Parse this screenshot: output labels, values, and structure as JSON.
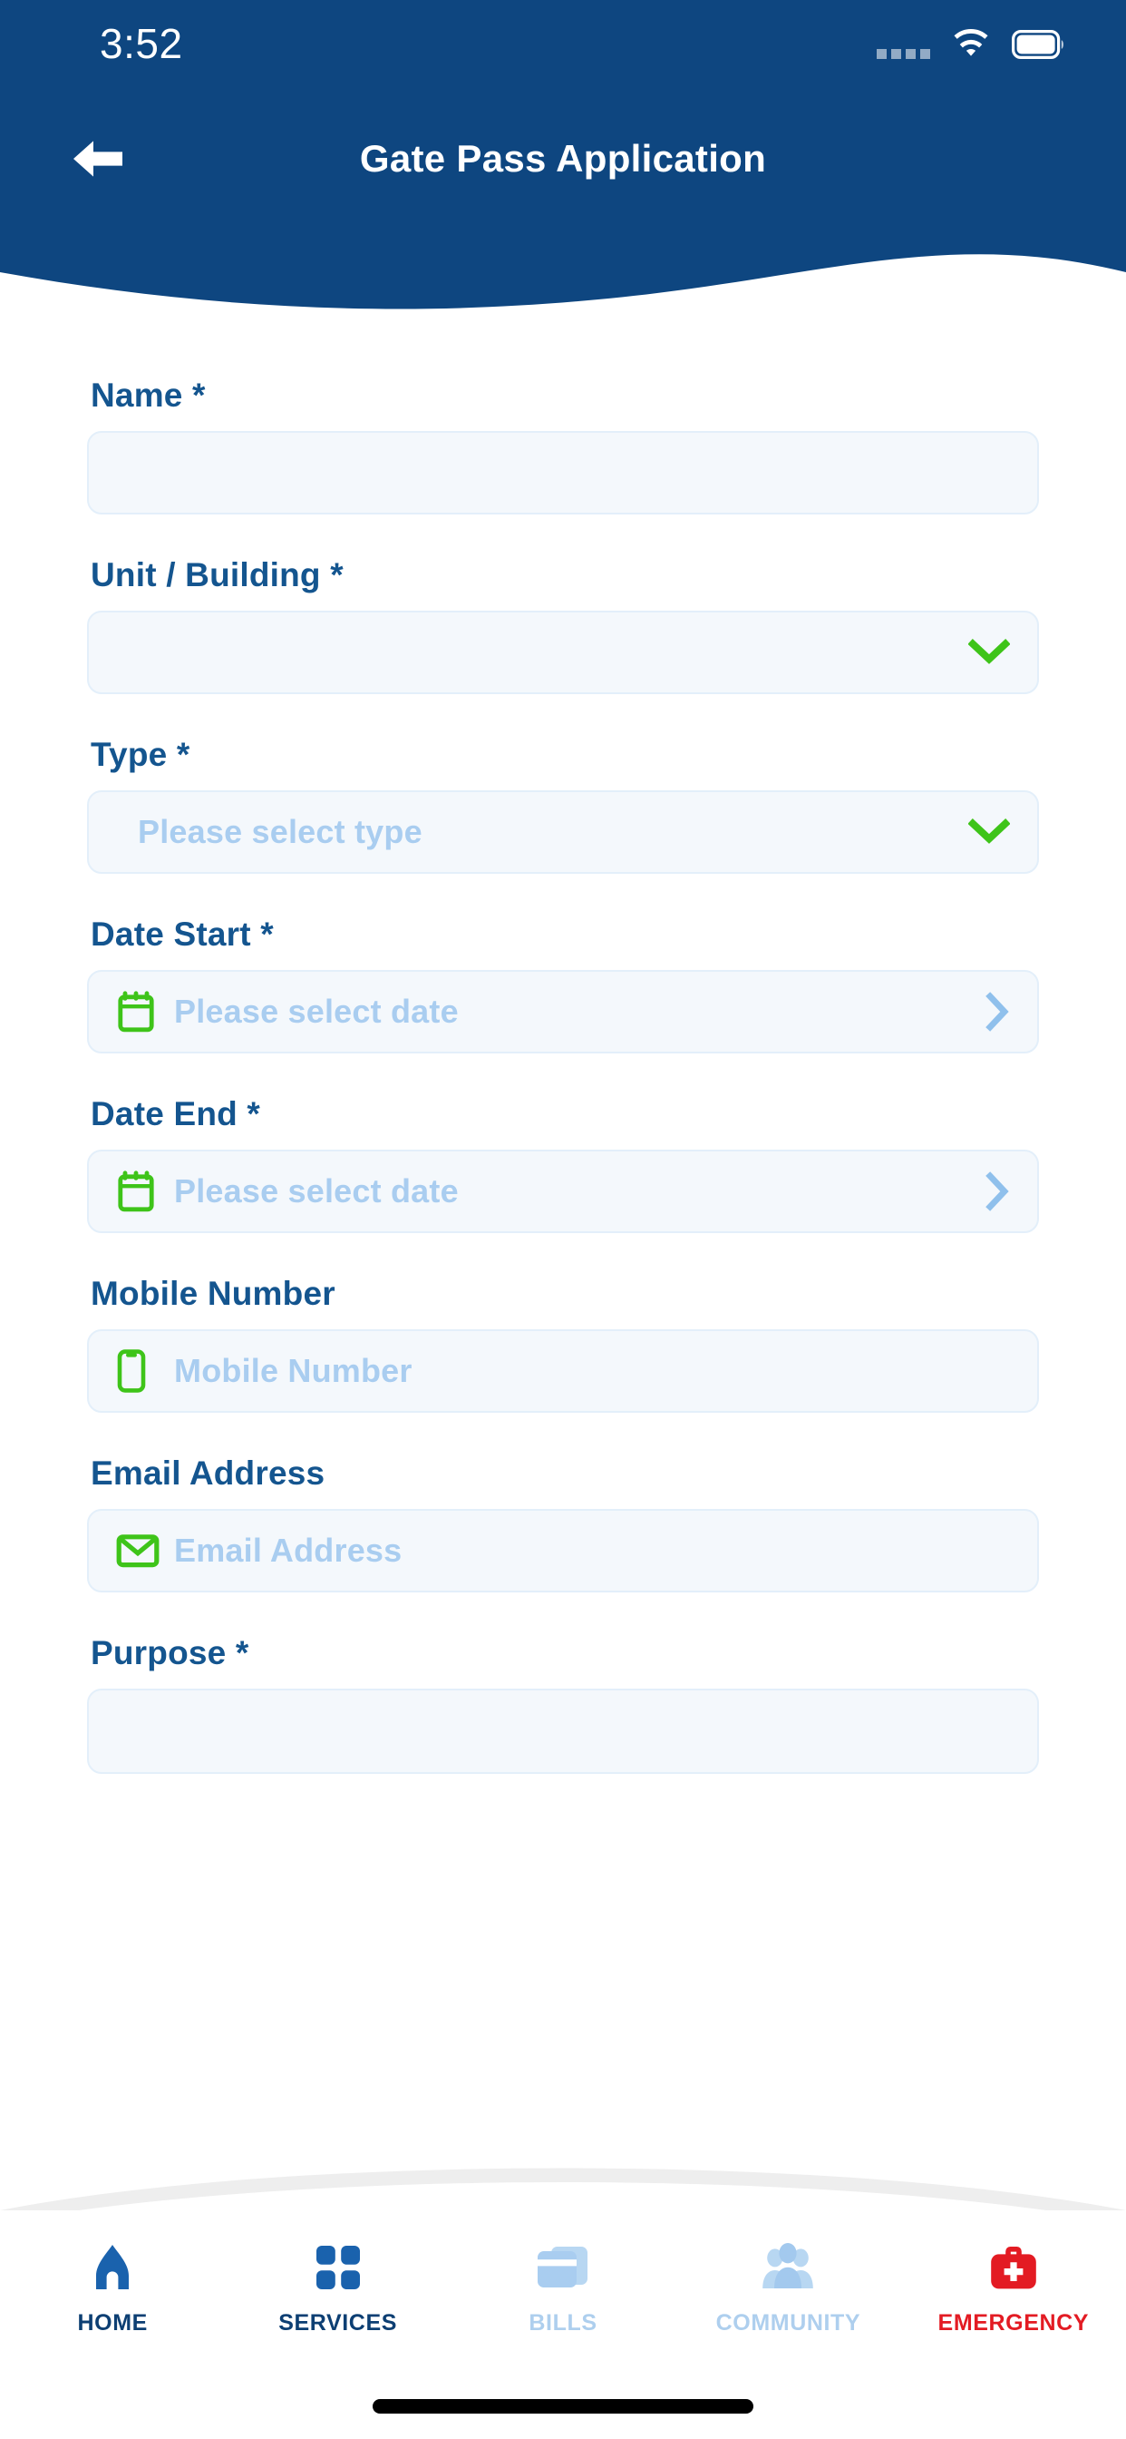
{
  "status_bar": {
    "time": "3:52",
    "signal_icon": "signal-dots-icon",
    "wifi_icon": "wifi-icon",
    "battery_icon": "battery-full-icon"
  },
  "header": {
    "title": "Gate Pass Application",
    "back_icon": "arrow-left-icon",
    "background_color": "#0e4680"
  },
  "colors": {
    "header_blue": "#0e4680",
    "label_blue": "#14558f",
    "placeholder_blue": "#a9cdf0",
    "field_bg": "#f4f8fc",
    "field_border": "#e3effa",
    "accent_green": "#3ec419",
    "nav_active_blue": "#1a62ad",
    "nav_inactive_blue": "#aecfee",
    "emergency_red": "#e31b23"
  },
  "form": {
    "fields": [
      {
        "label": "Name *",
        "name": "name",
        "kind": "text",
        "value": "",
        "placeholder": "",
        "left_icon": "",
        "right_icon": ""
      },
      {
        "label": "Unit / Building *",
        "name": "unit-building",
        "kind": "select",
        "value": "",
        "placeholder": "",
        "left_icon": "",
        "right_icon": "chevron-down-icon"
      },
      {
        "label": "Type *",
        "name": "type",
        "kind": "select",
        "value": "",
        "placeholder": "Please select type",
        "left_icon": "",
        "right_icon": "chevron-down-icon"
      },
      {
        "label": "Date Start *",
        "name": "date-start",
        "kind": "date",
        "value": "",
        "placeholder": "Please select date",
        "left_icon": "calendar-icon",
        "right_icon": "chevron-right-icon"
      },
      {
        "label": "Date End *",
        "name": "date-end",
        "kind": "date",
        "value": "",
        "placeholder": "Please select date",
        "left_icon": "calendar-icon",
        "right_icon": "chevron-right-icon"
      },
      {
        "label": "Mobile Number",
        "name": "mobile-number",
        "kind": "tel",
        "value": "",
        "placeholder": "Mobile Number",
        "left_icon": "phone-icon",
        "right_icon": ""
      },
      {
        "label": "Email Address",
        "name": "email-address",
        "kind": "email",
        "value": "",
        "placeholder": "Email Address",
        "left_icon": "envelope-icon",
        "right_icon": ""
      },
      {
        "label": "Purpose *",
        "name": "purpose",
        "kind": "textarea",
        "value": "",
        "placeholder": "",
        "left_icon": "",
        "right_icon": ""
      }
    ]
  },
  "bottom_nav": {
    "items": [
      {
        "label": "HOME",
        "icon": "home-icon",
        "active": true
      },
      {
        "label": "SERVICES",
        "icon": "grid-squares-icon",
        "active": true
      },
      {
        "label": "BILLS",
        "icon": "cards-icon",
        "active": false
      },
      {
        "label": "COMMUNITY",
        "icon": "people-group-icon",
        "active": false
      },
      {
        "label": "EMERGENCY",
        "icon": "medical-bag-icon",
        "active": false
      }
    ]
  },
  "home_indicator": "home-indicator-bar"
}
